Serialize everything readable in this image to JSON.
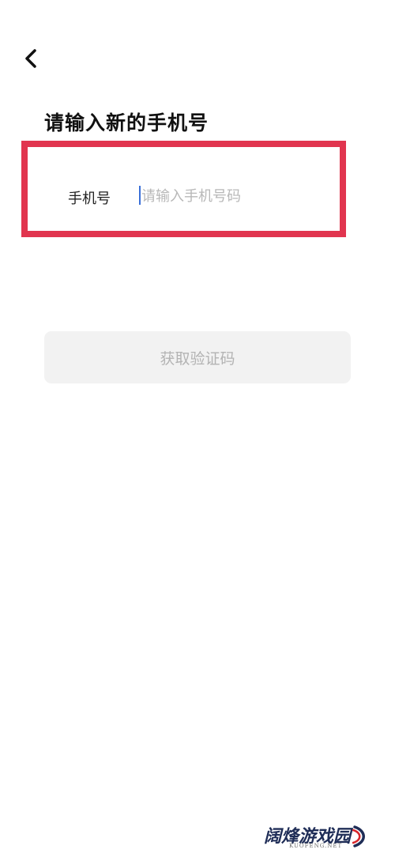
{
  "header": {
    "back_icon": "chevron-left-icon",
    "title": "请输入新的手机号"
  },
  "phone_field": {
    "label": "手机号",
    "value": "",
    "placeholder": "请输入手机号码",
    "highlight_color": "#e1354f"
  },
  "actions": {
    "get_code_label": "获取验证码"
  },
  "watermark": {
    "title": "阔烽游戏园",
    "subtitle": "KUOFENG.NET"
  }
}
